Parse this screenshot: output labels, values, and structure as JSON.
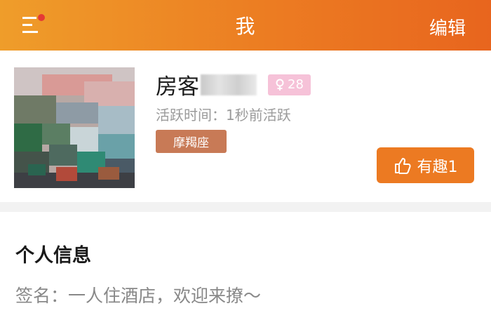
{
  "header": {
    "title": "我",
    "edit_label": "编辑",
    "theme_color": "#ec7c22",
    "menu_icon": "menu-with-dot-icon",
    "notification_dot_color": "#e53935"
  },
  "profile": {
    "name": "房客",
    "age": "28",
    "age_badge_color": "#f6c2d8",
    "gender_icon": "female-symbol-icon",
    "active_text": "活跃时间：1秒前活跃",
    "zodiac": "摩羯座",
    "like_label": "有趣1",
    "like_icon": "thumbs-up-icon"
  },
  "info": {
    "title": "个人信息",
    "signature": "签名：一人住酒店，欢迎来撩～"
  }
}
